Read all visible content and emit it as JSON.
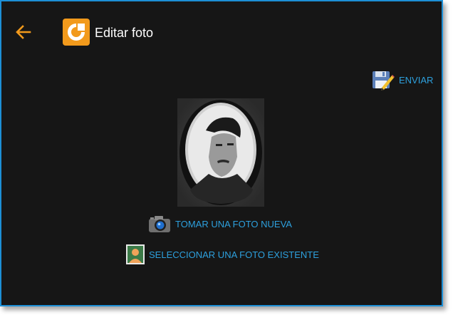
{
  "header": {
    "title": "Editar foto",
    "back_icon": "arrow-left-icon",
    "logo_icon": "app-logo-icon",
    "accent_color": "#f29a1c"
  },
  "actions": {
    "send_label": "ENVIAR",
    "send_icon": "floppy-pencil-icon",
    "take_photo_label": "TOMAR UNA FOTO NUEVA",
    "take_photo_icon": "camera-icon",
    "select_photo_label": "SELECCIONAR UNA FOTO EXISTENTE",
    "select_photo_icon": "contact-portrait-icon",
    "link_color": "#2da0dd"
  },
  "photo": {
    "alt": "profile-photo"
  }
}
